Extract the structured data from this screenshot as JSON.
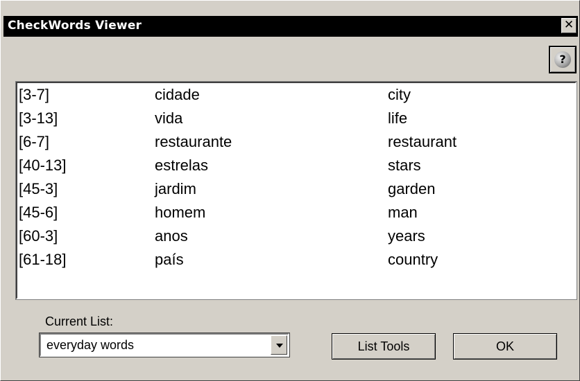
{
  "window": {
    "title": "CheckWords Viewer",
    "close_glyph": "✕"
  },
  "help": {
    "glyph": "?",
    "icon": "help-icon"
  },
  "words": [
    {
      "ref": "[3-7]",
      "portuguese": "cidade",
      "english": "city"
    },
    {
      "ref": "[3-13]",
      "portuguese": "vida",
      "english": "life"
    },
    {
      "ref": "[6-7]",
      "portuguese": "restaurante",
      "english": "restaurant"
    },
    {
      "ref": "[40-13]",
      "portuguese": "estrelas",
      "english": "stars"
    },
    {
      "ref": "[45-3]",
      "portuguese": "jardim",
      "english": "garden"
    },
    {
      "ref": "[45-6]",
      "portuguese": "homem",
      "english": "man"
    },
    {
      "ref": "[60-3]",
      "portuguese": "anos",
      "english": "years"
    },
    {
      "ref": "[61-18]",
      "portuguese": "país",
      "english": "country"
    }
  ],
  "current_list": {
    "label": "Current  List:",
    "value": "everyday words"
  },
  "buttons": {
    "list_tools": "List Tools",
    "ok": "OK"
  }
}
